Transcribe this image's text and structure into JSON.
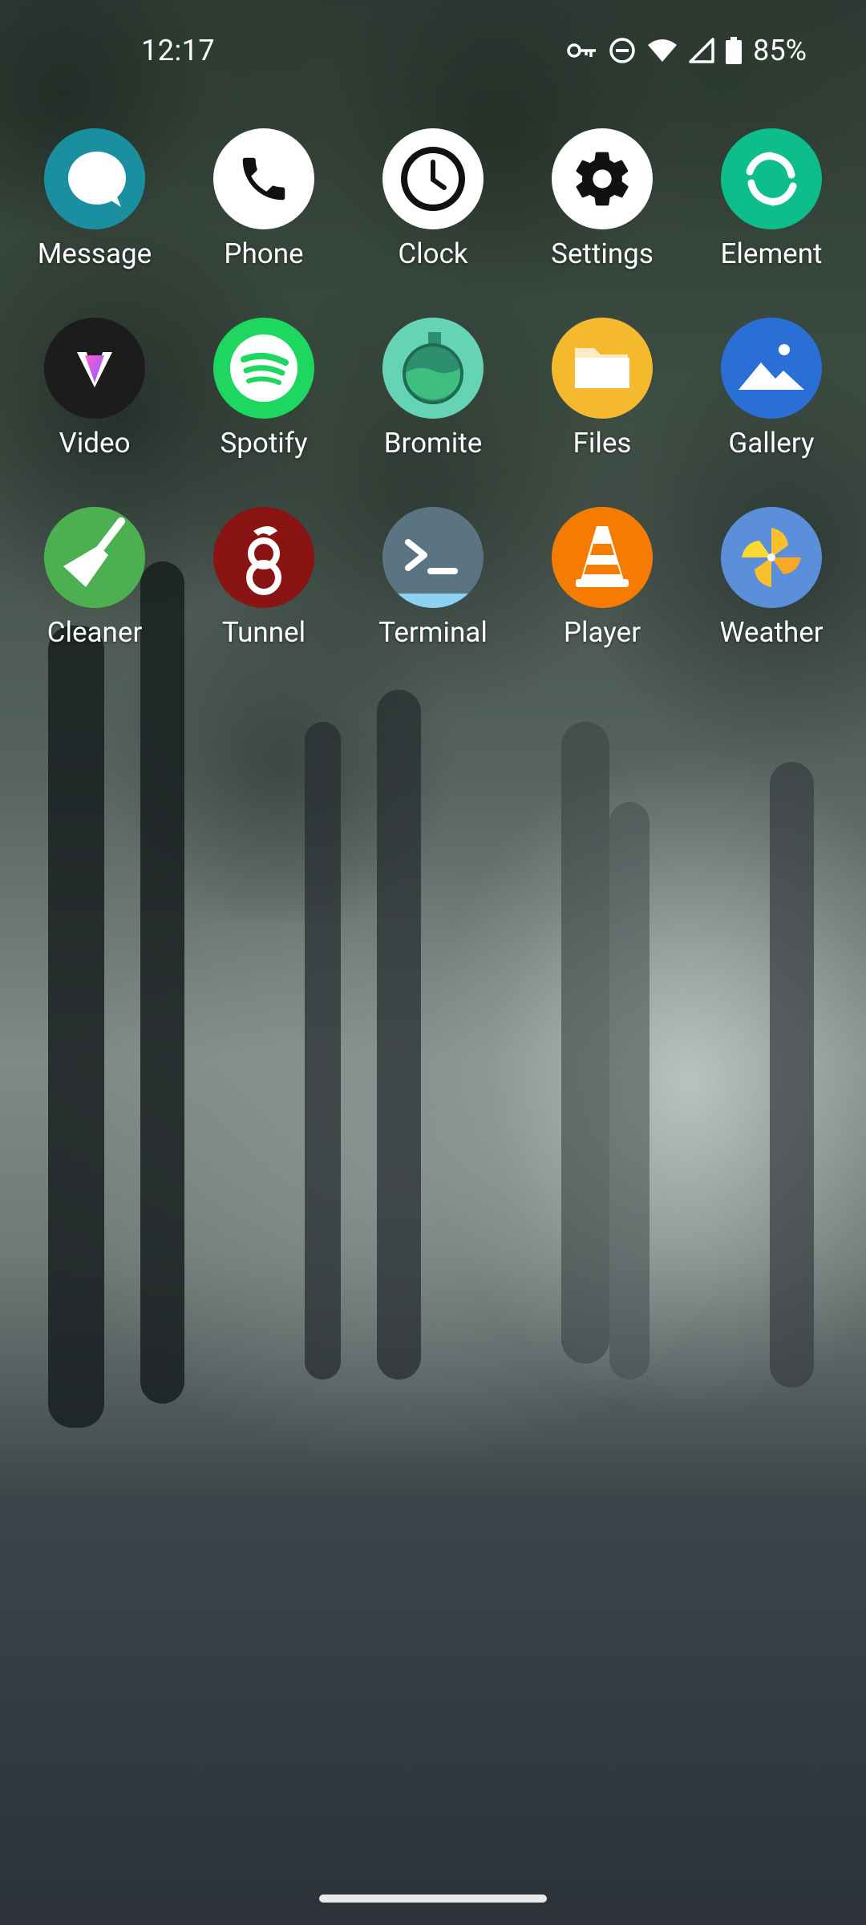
{
  "status_bar": {
    "time": "12:17",
    "battery": "85%",
    "icons": [
      "vpn-key-icon",
      "do-not-disturb-icon",
      "wifi-icon",
      "cellular-signal-icon",
      "battery-icon"
    ]
  },
  "apps": [
    {
      "label": "Message",
      "icon": "message-icon",
      "color": "#1a8fa0"
    },
    {
      "label": "Phone",
      "icon": "phone-icon",
      "color": "#ffffff"
    },
    {
      "label": "Clock",
      "icon": "clock-icon",
      "color": "#ffffff"
    },
    {
      "label": "Settings",
      "icon": "gear-icon",
      "color": "#ffffff"
    },
    {
      "label": "Element",
      "icon": "element-icon",
      "color": "#0dbd8b"
    },
    {
      "label": "Video",
      "icon": "video-icon",
      "color": "#1c1c1c"
    },
    {
      "label": "Spotify",
      "icon": "spotify-icon",
      "color": "#1ed760"
    },
    {
      "label": "Bromite",
      "icon": "bromite-icon",
      "color": "#5fd3b2"
    },
    {
      "label": "Files",
      "icon": "folder-icon",
      "color": "#f5b92e"
    },
    {
      "label": "Gallery",
      "icon": "gallery-icon",
      "color": "#2a6fd6"
    },
    {
      "label": "Cleaner",
      "icon": "broom-icon",
      "color": "#4caf50"
    },
    {
      "label": "Tunnel",
      "icon": "wireguard-dragon-icon",
      "color": "#8a1414"
    },
    {
      "label": "Terminal",
      "icon": "terminal-icon",
      "color": "#5b7482"
    },
    {
      "label": "Player",
      "icon": "traffic-cone-icon",
      "color": "#f57c00"
    },
    {
      "label": "Weather",
      "icon": "pinwheel-icon",
      "color": "#5b8fd9"
    }
  ]
}
